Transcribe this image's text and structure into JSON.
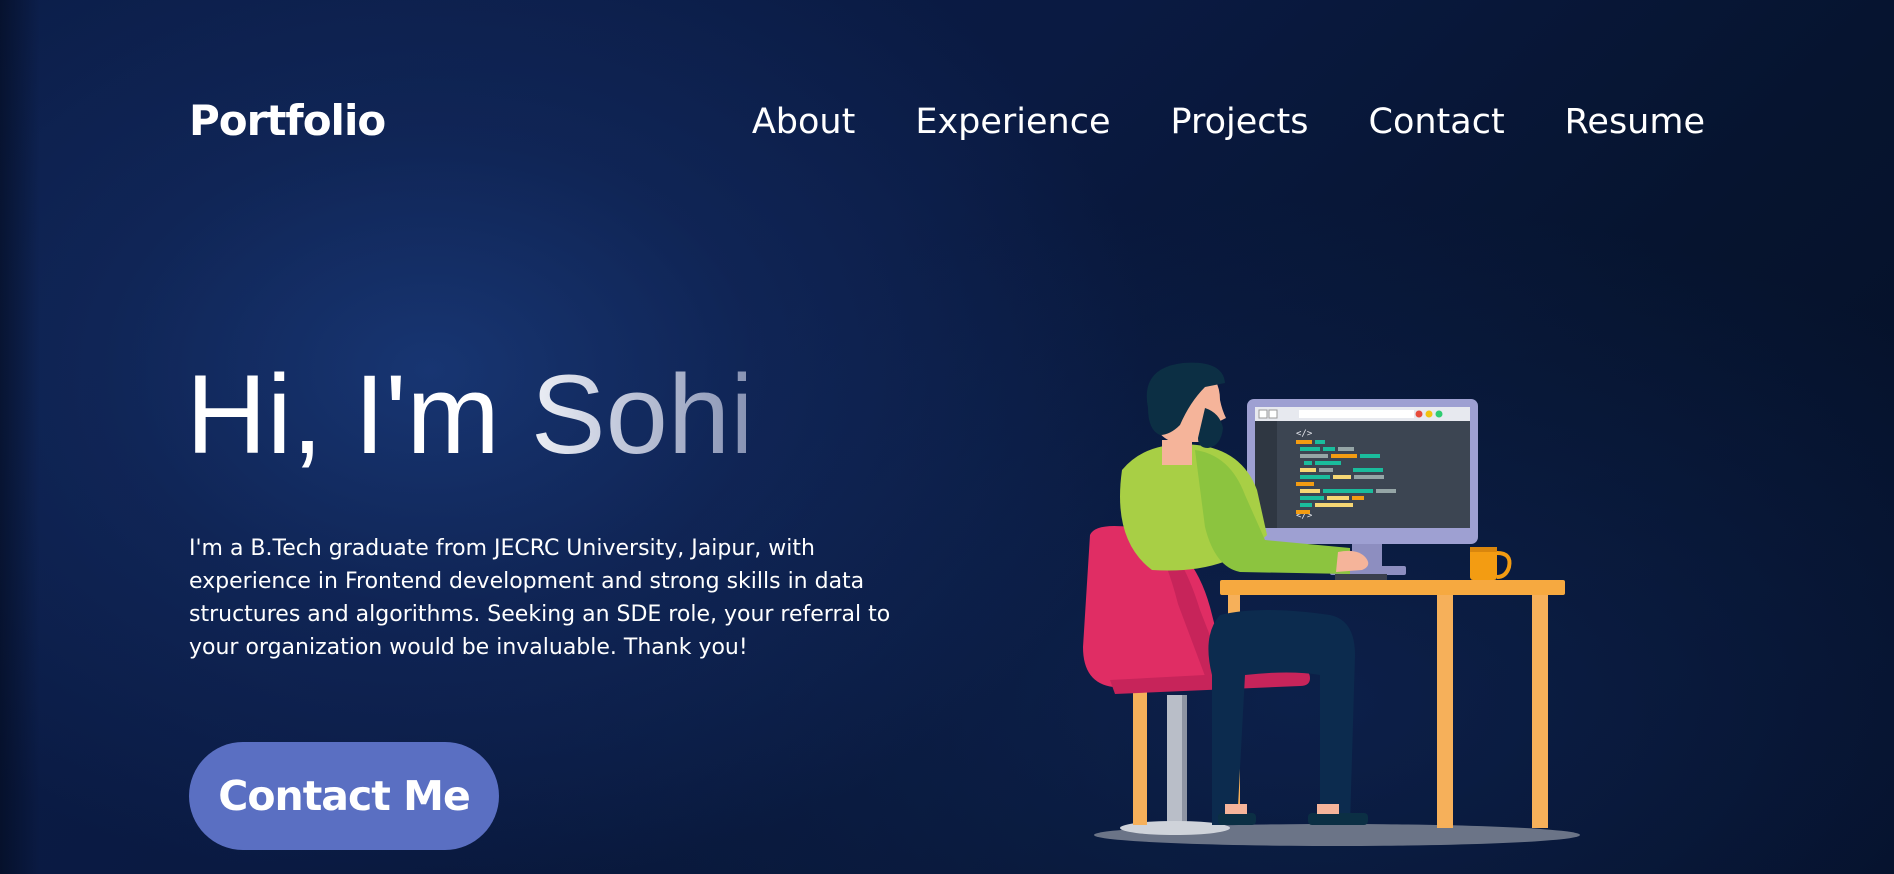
{
  "header": {
    "logo": "Portfolio",
    "nav": [
      {
        "label": "About"
      },
      {
        "label": "Experience"
      },
      {
        "label": "Projects"
      },
      {
        "label": "Contact"
      },
      {
        "label": "Resume"
      }
    ]
  },
  "hero": {
    "title": "Hi, I'm Sohil",
    "description": "I'm a B.Tech graduate from JECRC University, Jaipur, with experience in Frontend development and strong skills in data structures and algorithms. Seeking an SDE role, your referral to your organization would be invaluable. Thank you!",
    "cta_label": "Contact Me",
    "screen_code_tag": "</>"
  },
  "colors": {
    "background": "#0a1a42",
    "accent_button": "#5a6fc2",
    "text": "#ffffff"
  },
  "icons": {
    "illustration": "developer-at-desk-illustration"
  }
}
